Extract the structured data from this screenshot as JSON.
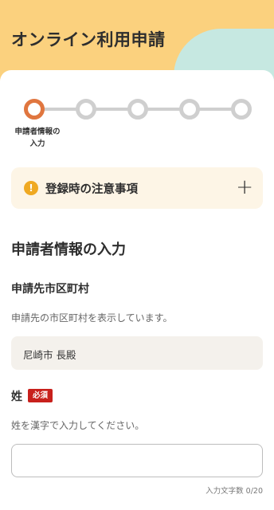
{
  "header": {
    "title": "オンライン利用申請",
    "colors": {
      "primary": "#fbd17e",
      "secondary": "#c6e8e1"
    }
  },
  "stepper": {
    "steps": [
      {
        "active": true
      },
      {
        "active": false
      },
      {
        "active": false
      },
      {
        "active": false
      },
      {
        "active": false
      }
    ],
    "current_label": "申請者情報の入力",
    "active_color": "#e0763f"
  },
  "notice": {
    "icon": "warning-icon",
    "label": "登録時の注意事項",
    "expand_icon": "plus-icon",
    "expand_symbol": "+"
  },
  "section": {
    "title": "申請者情報の入力"
  },
  "municipality": {
    "label": "申請先市区町村",
    "help": "申請先の市区町村を表示しています。",
    "value": "尼崎市 長殿"
  },
  "surname": {
    "label": "姓",
    "required_badge": "必須",
    "help": "姓を漢字で入力してください。",
    "value": "",
    "placeholder": "",
    "counter": "入力文字数 0/20"
  }
}
